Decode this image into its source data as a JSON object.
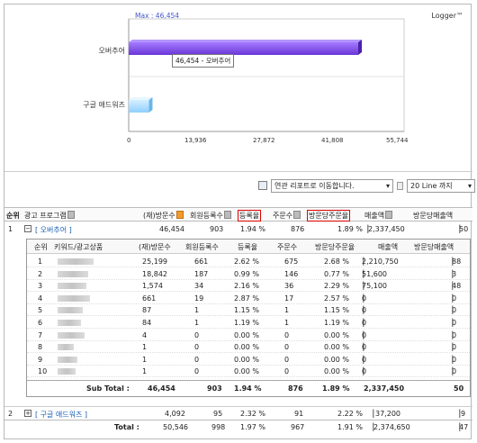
{
  "chart": {
    "brand": "Logger™",
    "max_label": "Max : 46,454",
    "tooltip": "46,454 - 오버추어"
  },
  "chart_data": {
    "type": "bar",
    "orientation": "horizontal",
    "categories": [
      "오버추어",
      "구글 애드워즈"
    ],
    "values": [
      46454,
      4092
    ],
    "xticks": [
      "0",
      "13,936",
      "27,872",
      "41,808",
      "55,744"
    ],
    "xlim": [
      0,
      55744
    ],
    "colors": [
      "#7b4de0",
      "#9fd4ff"
    ]
  },
  "toolbar": {
    "report_select": "연관 리포트로 이동합니다.",
    "lines_select": "20 Line 까지"
  },
  "header": [
    "순위",
    "광고 프로그램",
    "(재)방문수",
    "회원등록수",
    "등록율",
    "주문수",
    "방문당주문율",
    "매출액",
    "방문당매출액"
  ],
  "groups": [
    {
      "rank": "1",
      "name": "[ 오버추어 ]",
      "visits": "46,454",
      "regs": "903",
      "rate": "1.94 %",
      "orders": "876",
      "order_rate": "1.89 %",
      "sales": "2,337,450",
      "per_visit": "50",
      "toggle": "−"
    },
    {
      "rank": "2",
      "name": "[ 구글 애드워즈 ]",
      "visits": "4,092",
      "regs": "95",
      "rate": "2.32 %",
      "orders": "91",
      "order_rate": "2.22 %",
      "sales": "37,200",
      "per_visit": "9",
      "toggle": "+"
    }
  ],
  "inner_header": [
    "순위",
    "키워드/광고상품",
    "(재)방문수",
    "회원등록수",
    "등록율",
    "주문수",
    "방문당주문율",
    "매출액",
    "방문당매출액"
  ],
  "inner_rows": [
    {
      "rank": "1",
      "visits": "25,199",
      "regs": "661",
      "rate": "2.62 %",
      "orders": "675",
      "order_rate": "2.68 %",
      "sales": "2,210,750",
      "per_visit": "88"
    },
    {
      "rank": "2",
      "visits": "18,842",
      "regs": "187",
      "rate": "0.99 %",
      "orders": "146",
      "order_rate": "0.77 %",
      "sales": "51,600",
      "per_visit": "3"
    },
    {
      "rank": "3",
      "visits": "1,574",
      "regs": "34",
      "rate": "2.16 %",
      "orders": "36",
      "order_rate": "2.29 %",
      "sales": "75,100",
      "per_visit": "48"
    },
    {
      "rank": "4",
      "visits": "661",
      "regs": "19",
      "rate": "2.87 %",
      "orders": "17",
      "order_rate": "2.57 %",
      "sales": "0",
      "per_visit": "0"
    },
    {
      "rank": "5",
      "visits": "87",
      "regs": "1",
      "rate": "1.15 %",
      "orders": "1",
      "order_rate": "1.15 %",
      "sales": "0",
      "per_visit": "0"
    },
    {
      "rank": "6",
      "visits": "84",
      "regs": "1",
      "rate": "1.19 %",
      "orders": "1",
      "order_rate": "1.19 %",
      "sales": "0",
      "per_visit": "0"
    },
    {
      "rank": "7",
      "visits": "4",
      "regs": "0",
      "rate": "0.00 %",
      "orders": "0",
      "order_rate": "0.00 %",
      "sales": "0",
      "per_visit": "0"
    },
    {
      "rank": "8",
      "visits": "1",
      "regs": "0",
      "rate": "0.00 %",
      "orders": "0",
      "order_rate": "0.00 %",
      "sales": "0",
      "per_visit": "0"
    },
    {
      "rank": "9",
      "visits": "1",
      "regs": "0",
      "rate": "0.00 %",
      "orders": "0",
      "order_rate": "0.00 %",
      "sales": "0",
      "per_visit": "0"
    },
    {
      "rank": "10",
      "visits": "1",
      "regs": "0",
      "rate": "0.00 %",
      "orders": "0",
      "order_rate": "0.00 %",
      "sales": "0",
      "per_visit": "0"
    }
  ],
  "subtotal": {
    "label": "Sub Total :",
    "visits": "46,454",
    "regs": "903",
    "rate": "1.94 %",
    "orders": "876",
    "order_rate": "1.89 %",
    "sales": "2,337,450",
    "per_visit": "50"
  },
  "total": {
    "label": "Total :",
    "visits": "50,546",
    "regs": "998",
    "rate": "1.97 %",
    "orders": "967",
    "order_rate": "1.91 %",
    "sales": "2,374,650",
    "per_visit": "47"
  }
}
